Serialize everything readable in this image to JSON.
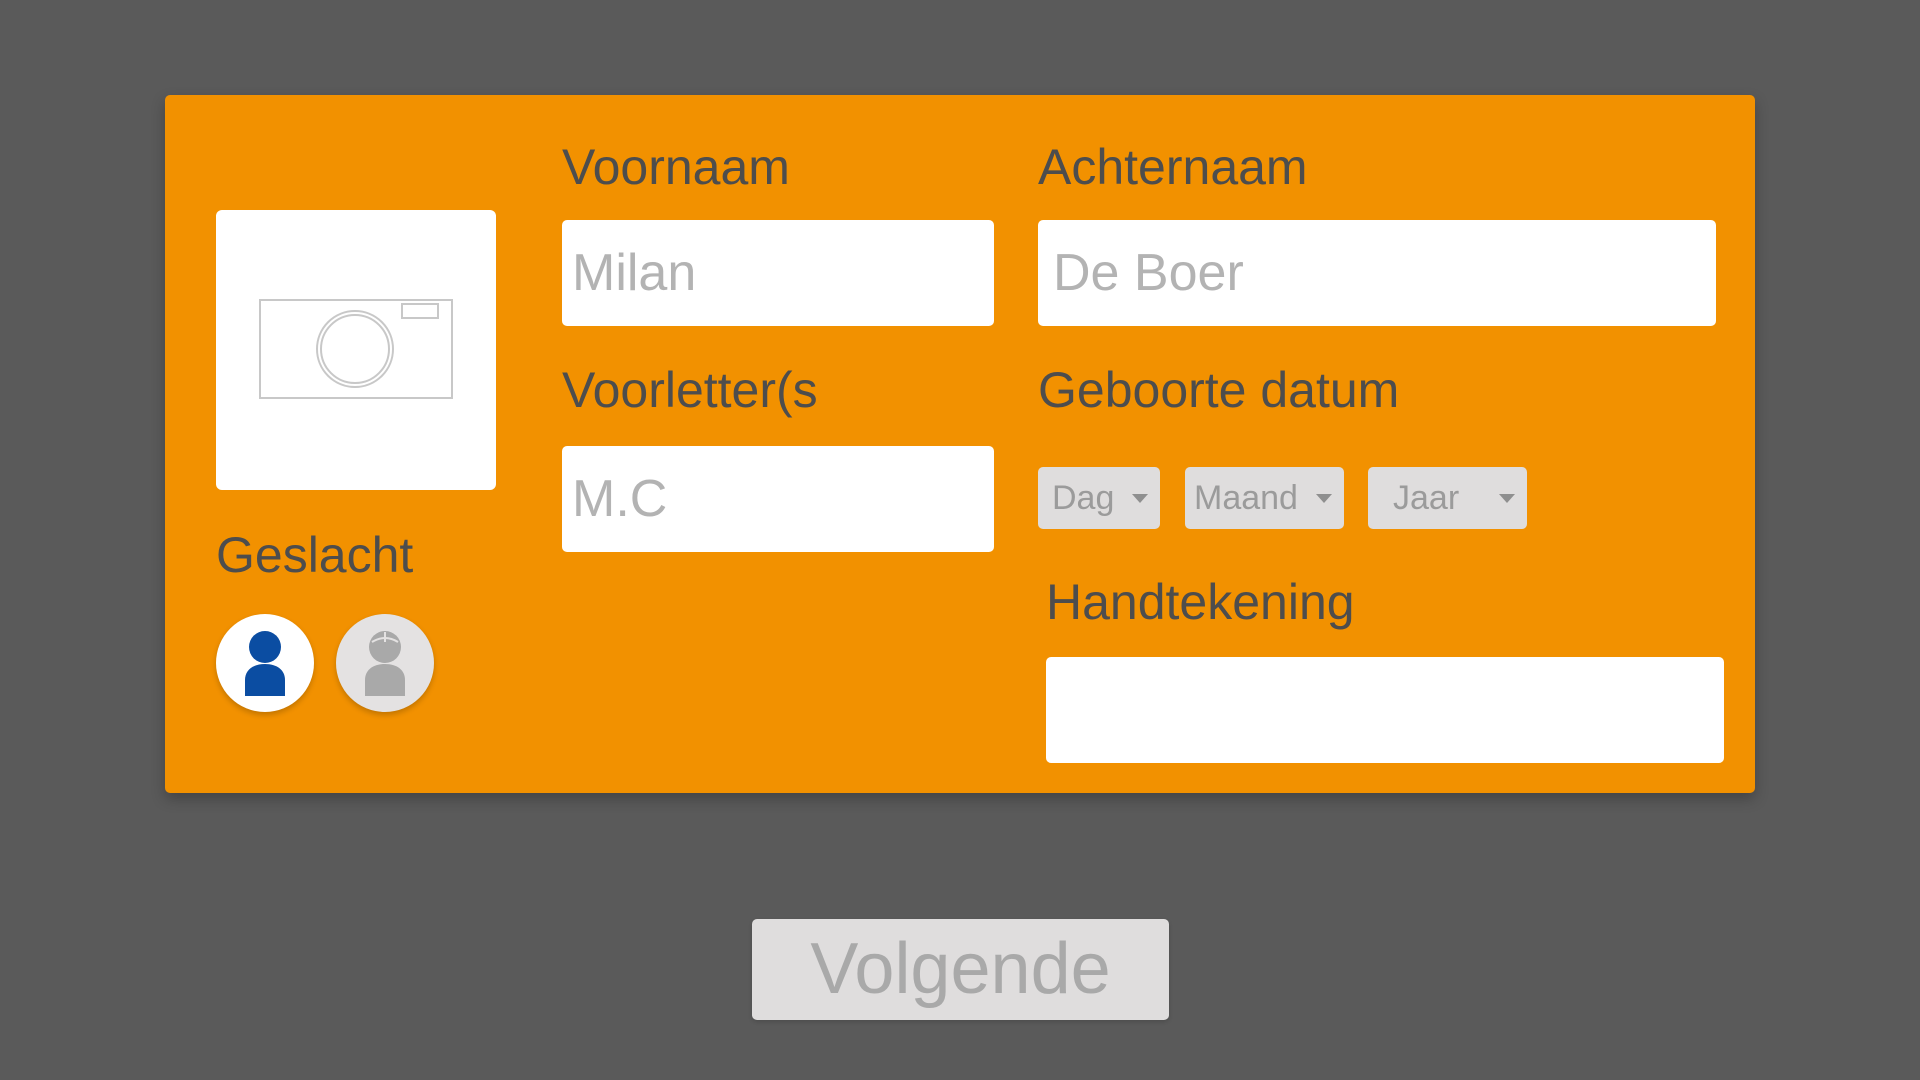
{
  "form": {
    "first_name": {
      "label": "Voornaam",
      "value": "Milan"
    },
    "last_name": {
      "label": "Achternaam",
      "value": "De Boer"
    },
    "initials": {
      "label": "Voorletter(s",
      "value": "M.C"
    },
    "birth_date": {
      "label": "Geboorte datum",
      "day": "Dag",
      "month": "Maand",
      "year": "Jaar"
    },
    "gender": {
      "label": "Geslacht",
      "selected": "male"
    },
    "signature": {
      "label": "Handtekening",
      "value": ""
    },
    "photo": {
      "icon": "camera-icon"
    }
  },
  "actions": {
    "next_label": "Volgende"
  },
  "colors": {
    "background": "#5a5a5a",
    "card": "#f29100",
    "label": "#4d4d4d",
    "input_text": "#b3b3b3",
    "male_icon": "#0b4da2",
    "female_icon": "#a9a9a9"
  }
}
